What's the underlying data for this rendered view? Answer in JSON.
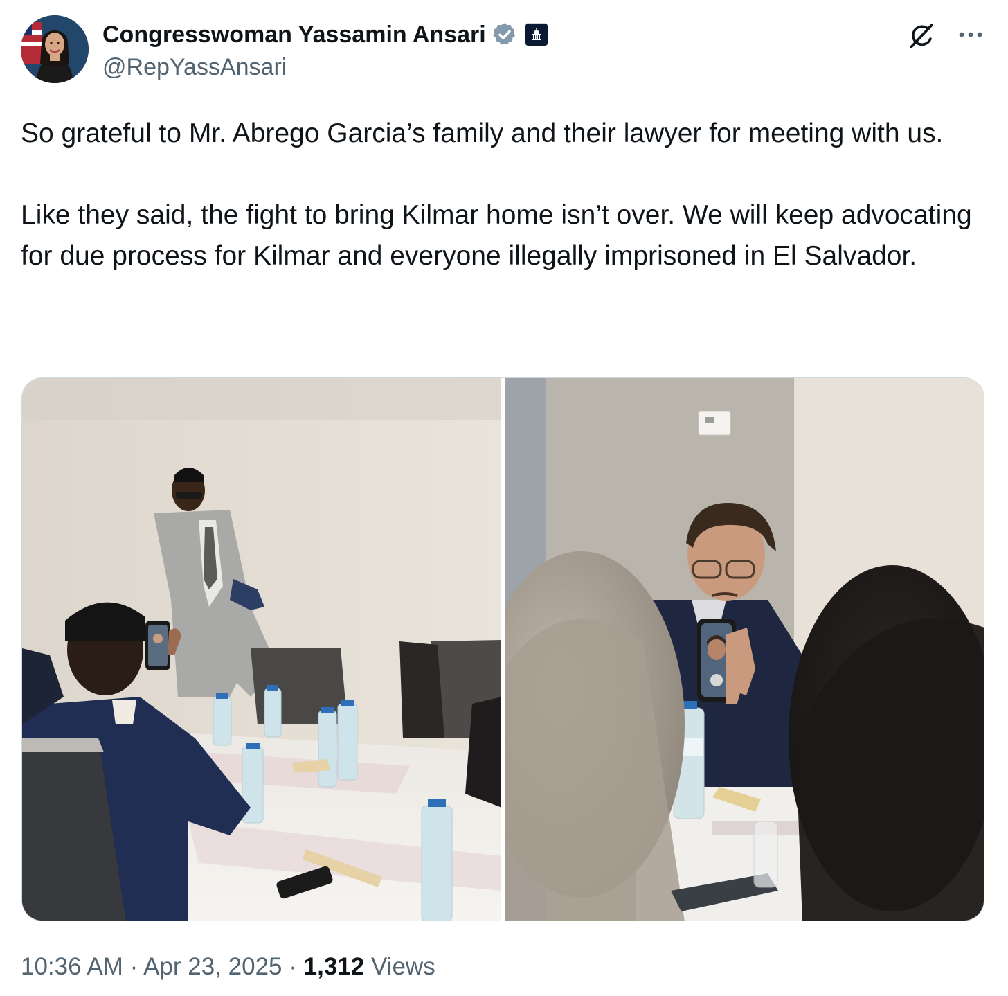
{
  "tweet": {
    "author": {
      "display_name": "Congresswoman Yassamin Ansari",
      "handle": "@RepYassAnsari",
      "avatar_icon": "profile-photo",
      "verified_icon": "verified-badge-gray-icon",
      "affiliation_icon": "us-capitol-icon"
    },
    "header_actions": {
      "grok_icon": "grok-icon",
      "more_icon": "more-horizontal-icon"
    },
    "text": "So grateful to Mr. Abrego Garcia’s family and their lawyer for meeting with us.\n\nLike they said, the fight to bring Kilmar home isn’t over. We will keep advocating for due process for Kilmar and everyone illegally imprisoned in El Salvador.",
    "media": [
      {
        "kind": "photo",
        "icon": "photo-meeting-room-standing-man"
      },
      {
        "kind": "photo",
        "icon": "photo-man-holding-phone-video-call"
      }
    ],
    "time": "10:36 AM",
    "separator": "·",
    "date": "Apr 23, 2025",
    "views_count": "1,312",
    "views_label": "Views"
  },
  "colors": {
    "text_primary": "#0f1419",
    "text_secondary": "#536471",
    "border": "#cfd9de",
    "verified_gray": "#829aab"
  }
}
